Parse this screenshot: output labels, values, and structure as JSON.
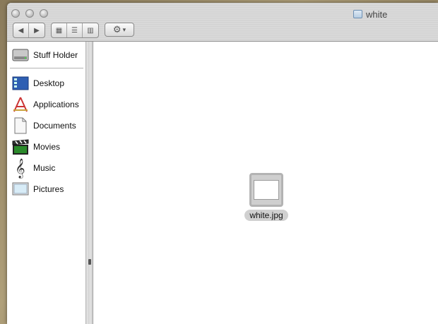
{
  "window": {
    "title": "white"
  },
  "toolbar": {
    "back_glyph": "◀",
    "forward_glyph": "▶",
    "view_icon_glyph": "▦",
    "view_list_glyph": "☰",
    "view_column_glyph": "▥",
    "action_glyph": "⚙",
    "action_chevron_glyph": "▾"
  },
  "sidebar": {
    "items": [
      {
        "label": "Stuff Holder",
        "icon": "hard-drive-icon"
      },
      {
        "label": "Desktop",
        "icon": "desktop-icon"
      },
      {
        "label": "Applications",
        "icon": "applications-icon"
      },
      {
        "label": "Documents",
        "icon": "documents-icon"
      },
      {
        "label": "Movies",
        "icon": "movies-icon"
      },
      {
        "label": "Music",
        "icon": "music-icon"
      },
      {
        "label": "Pictures",
        "icon": "pictures-icon"
      }
    ]
  },
  "main": {
    "files": [
      {
        "name": "white.jpg",
        "icon": "image-file-icon"
      }
    ]
  },
  "colors": {
    "titlebar": "#d6d6d6",
    "desktop_bg": "#6b5a3c",
    "selection_label": "#d0d0d0"
  }
}
